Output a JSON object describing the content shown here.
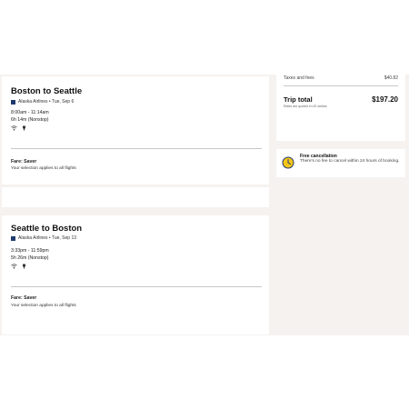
{
  "outbound": {
    "title": "Boston to Seattle",
    "airline_date": "Alaska Airlines • Tue, Sep 6",
    "times": "8:00am - 11:14am",
    "duration": "6h 14m (Nonstop)",
    "fare": "Fare: Saver",
    "fare_note": "Your selection applies to all flights"
  },
  "return": {
    "title": "Seattle to Boston",
    "airline_date": "Alaska Airlines • Tue, Sep 13",
    "times": "3:33pm - 11:59pm",
    "duration": "5h 26m (Nonstop)",
    "fare": "Fare: Saver",
    "fare_note": "Your selection applies to all flights"
  },
  "summary": {
    "taxes_label": "Taxes and fees",
    "taxes_value": "$40.82",
    "total_label": "Trip total",
    "total_value": "$197.20",
    "currency_note": "Rates are quoted in US dollars"
  },
  "cancellation": {
    "title": "Free cancellation",
    "text": "There's no fee to cancel within 24 hours of booking."
  },
  "icons": [
    "wifi-icon",
    "power-icon",
    "airline-logo-icon",
    "clock-icon"
  ],
  "colors": {
    "page_background": "#f5f2f0",
    "clock_accent": "#f5c518",
    "airline_brand": "#1f3a6e"
  }
}
